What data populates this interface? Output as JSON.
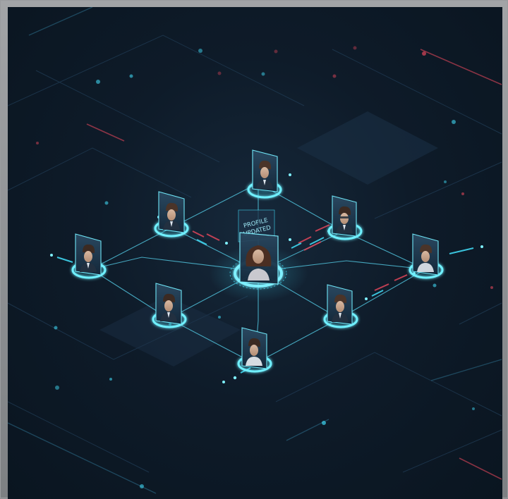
{
  "hub": {
    "badge_line1": "PROFILE",
    "badge_line2": "UPDATED",
    "role": "updated-profile-hub"
  },
  "colors": {
    "background": "#0e1b29",
    "accent": "#3fd6f0",
    "accent_glow": "#7ff0ff",
    "alert": "#e0465a",
    "panel": "#1c3147"
  },
  "profiles": [
    {
      "id": "top",
      "icon": "person-icon"
    },
    {
      "id": "upper-left",
      "icon": "person-icon"
    },
    {
      "id": "upper-right",
      "icon": "person-icon"
    },
    {
      "id": "left",
      "icon": "person-icon"
    },
    {
      "id": "right",
      "icon": "person-icon"
    },
    {
      "id": "lower-left",
      "icon": "person-icon"
    },
    {
      "id": "lower-right",
      "icon": "person-icon"
    },
    {
      "id": "bottom",
      "icon": "person-icon"
    }
  ]
}
